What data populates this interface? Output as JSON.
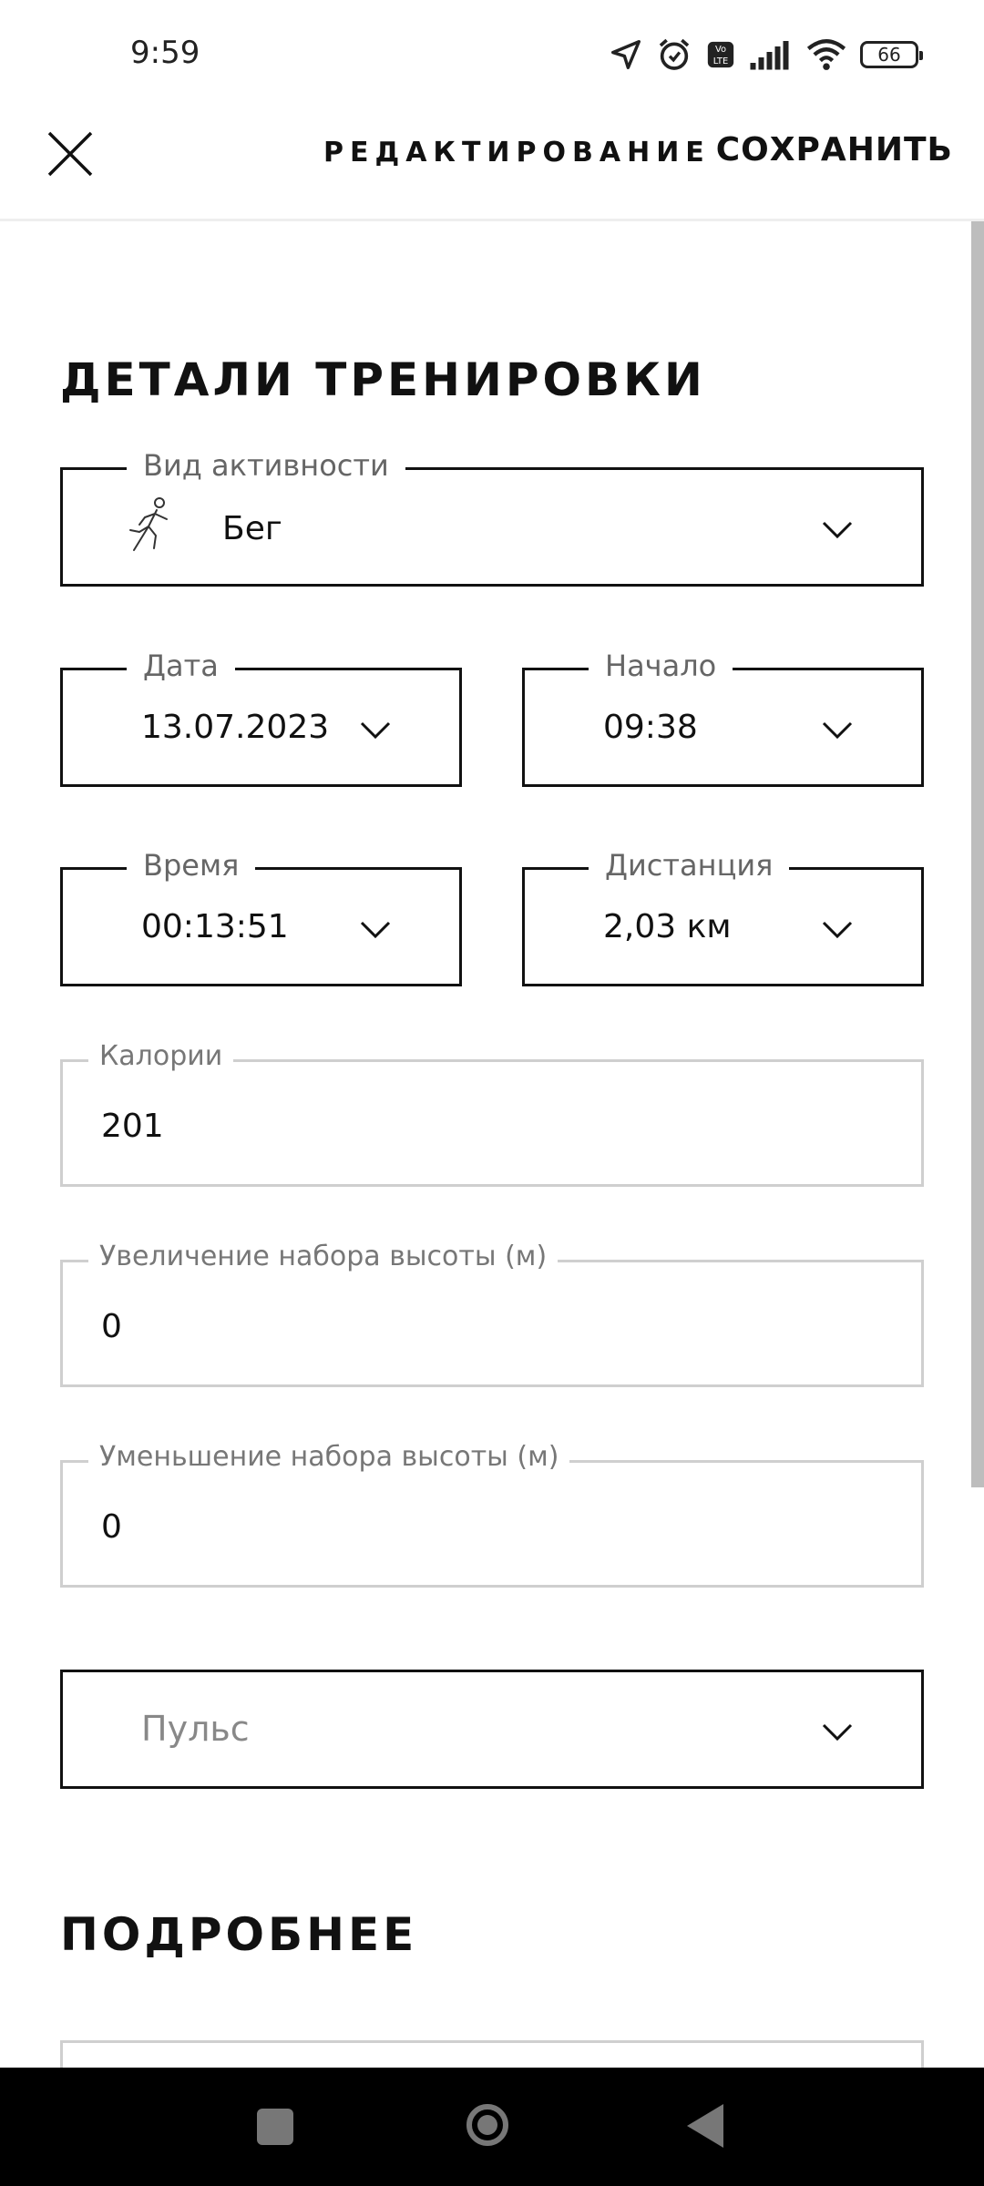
{
  "status_bar": {
    "time": "9:59",
    "battery": "66"
  },
  "header": {
    "title": "РЕДАКТИРОВАНИЕ",
    "save_label": "СОХРАНИТЬ"
  },
  "sections": {
    "details_title": "ДЕТАЛИ ТРЕНИРОВКИ",
    "more_title": "ПОДРОБНЕЕ"
  },
  "fields": {
    "activity": {
      "label": "Вид активности",
      "value": "Бег"
    },
    "date": {
      "label": "Дата",
      "value": "13.07.2023"
    },
    "start": {
      "label": "Начало",
      "value": "09:38"
    },
    "duration": {
      "label": "Время",
      "value": "00:13:51"
    },
    "distance": {
      "label": "Дистанция",
      "value": "2,03 км"
    },
    "calories": {
      "label": "Калории",
      "value": "201"
    },
    "elevation_gain": {
      "label": "Увеличение набора высоты (м)",
      "value": "0"
    },
    "elevation_loss": {
      "label": "Уменьшение набора высоты (м)",
      "value": "0"
    },
    "pulse": {
      "placeholder": "Пульс"
    }
  },
  "icons": {
    "close": "close-icon",
    "runner": "runner-icon",
    "chevron": "chevron-down-icon",
    "location": "location-arrow-icon",
    "alarm": "alarm-icon",
    "volte": "volte-icon",
    "signal": "signal-icon",
    "wifi": "wifi-icon",
    "battery": "battery-icon"
  }
}
